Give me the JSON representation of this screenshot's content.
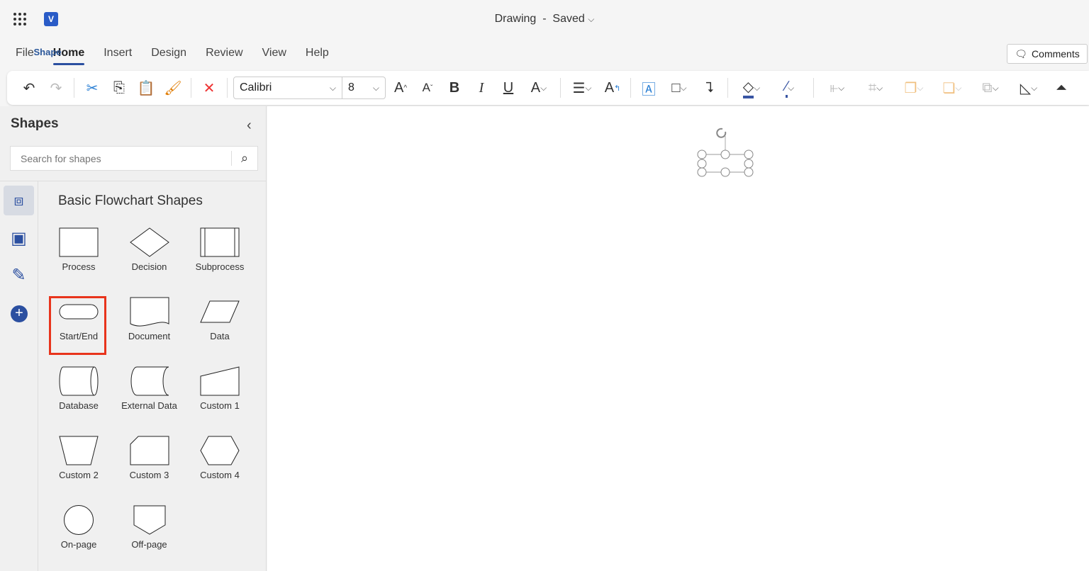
{
  "header": {
    "doc_name": "Drawing",
    "status": "Saved",
    "separator": "-"
  },
  "tabs": [
    "File",
    "Home",
    "Insert",
    "Design",
    "Review",
    "View",
    "Help",
    "Shape"
  ],
  "comments_label": "Comments",
  "ribbon": {
    "font": "Calibri",
    "font_size": "8",
    "fill_color": "#3955a3",
    "line_color": "#3955a3"
  },
  "panel": {
    "title": "Shapes",
    "search_placeholder": "Search for shapes",
    "stencil_title": "Basic Flowchart Shapes",
    "shapes": [
      "Process",
      "Decision",
      "Subprocess",
      "Start/End",
      "Document",
      "Data",
      "Database",
      "External Data",
      "Custom 1",
      "Custom 2",
      "Custom 3",
      "Custom 4",
      "On-page",
      "Off-page"
    ],
    "highlighted": "Start/End",
    "highlight_color": "#e8341c"
  }
}
